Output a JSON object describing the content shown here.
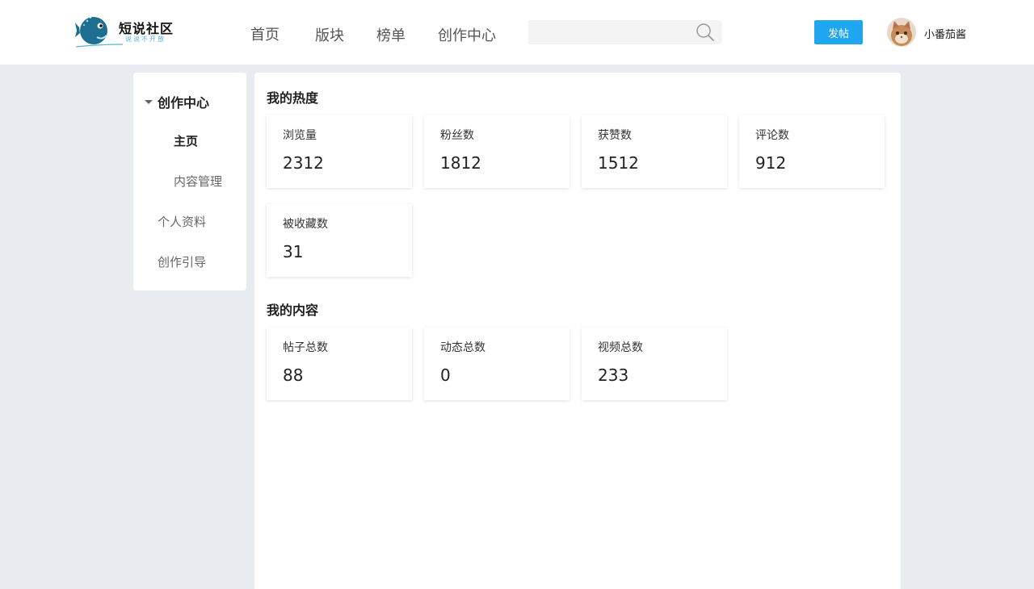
{
  "header": {
    "logo_title": "短说社区",
    "logo_subtitle": "说说不开放",
    "nav": [
      "首页",
      "版块",
      "榜单",
      "创作中心"
    ],
    "search_placeholder": "",
    "post_button": "发帖",
    "username": "小番茄酱"
  },
  "sidebar": {
    "group_label": "创作中心",
    "sub_items": [
      "主页",
      "内容管理"
    ],
    "items": [
      "个人资料",
      "创作引导"
    ]
  },
  "heat": {
    "title": "我的热度",
    "stats": [
      {
        "label": "浏览量",
        "value": "2312"
      },
      {
        "label": "粉丝数",
        "value": "1812"
      },
      {
        "label": "获赞数",
        "value": "1512"
      },
      {
        "label": "评论数",
        "value": "912"
      },
      {
        "label": "被收藏数",
        "value": "31"
      }
    ]
  },
  "content": {
    "title": "我的内容",
    "stats": [
      {
        "label": "帖子总数",
        "value": "88"
      },
      {
        "label": "动态总数",
        "value": "0"
      },
      {
        "label": "视频总数",
        "value": "233"
      }
    ]
  },
  "colors": {
    "accent": "#1ea7ee",
    "page_bg": "#e8ebf0"
  }
}
